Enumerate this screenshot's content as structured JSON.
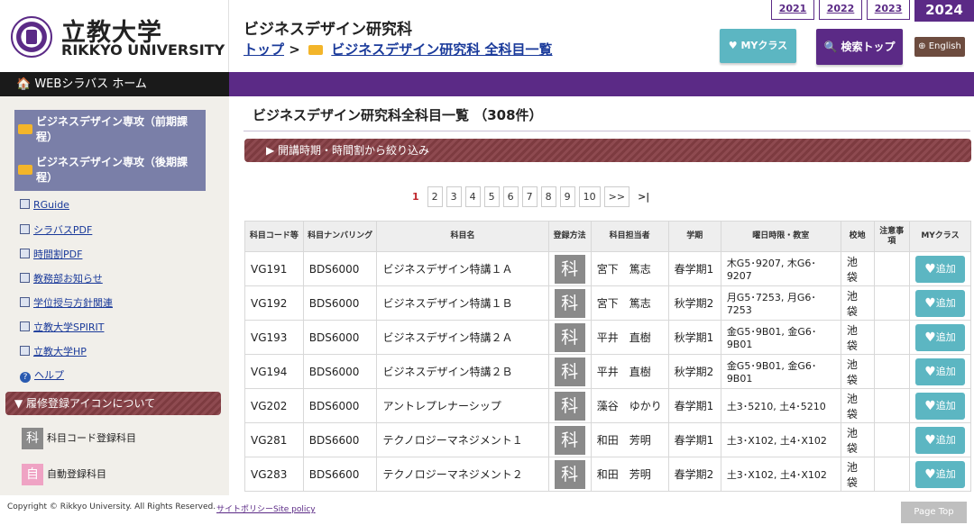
{
  "header": {
    "logo_jp": "立教大学",
    "logo_en": "RIKKYO UNIVERSITY",
    "title": "ビジネスデザイン研究科",
    "breadcrumb_top": "トップ",
    "breadcrumb_sep": ">",
    "breadcrumb_current": "ビジネスデザイン研究科 全科目一覧",
    "years": [
      "2021",
      "2022",
      "2023"
    ],
    "current_year": "2024",
    "my_class_label": "♥ MYクラス",
    "search_top_label": "🔍 検索トップ",
    "english_label": "⊕ English"
  },
  "nav": {
    "home_label": "WEBシラバス ホーム"
  },
  "sidebar": {
    "majors": [
      "ビジネスデザイン専攻（前期課程）",
      "ビジネスデザイン専攻（後期課程）"
    ],
    "links": [
      "RGuide",
      "シラバスPDF",
      "時間割PDF",
      "教務部お知らせ",
      "学位授与方針関連",
      "立教大学SPIRIT",
      "立教大学HP",
      "ヘルプ"
    ],
    "icon_section_title": "▼ 履修登録アイコンについて",
    "icon_items": [
      {
        "glyph": "科",
        "label": "科目コード登録科目",
        "color": "#8a8a8a"
      },
      {
        "glyph": "自",
        "label": "自動登録科目",
        "color": "#efa3c4"
      }
    ]
  },
  "main": {
    "title": "ビジネスデザイン研究科全科目一覧 （308件）",
    "filter_label": "▶ 開講時期・時間割から絞り込み",
    "pagination": [
      "1",
      "2",
      "3",
      "4",
      "5",
      "6",
      "7",
      "8",
      "9",
      "10",
      ">>",
      ">|"
    ],
    "current_page": "1"
  },
  "table": {
    "headers": [
      "科目コード等",
      "科目ナンバリング",
      "科目名",
      "登録方法",
      "科目担当者",
      "学期",
      "曜日時限・教室",
      "校地",
      "注意事項",
      "MYクラス"
    ],
    "rows": [
      {
        "code": "VG191",
        "numbering": "BDS6000",
        "name": "ビジネスデザイン特講１Ａ",
        "method": "科",
        "teacher": "宮下　篤志",
        "term": "春学期1",
        "schedule": "木G5･9207, 木G6･9207",
        "campus": "池袋",
        "note": "",
        "my": "追加"
      },
      {
        "code": "VG192",
        "numbering": "BDS6000",
        "name": "ビジネスデザイン特講１Ｂ",
        "method": "科",
        "teacher": "宮下　篤志",
        "term": "秋学期2",
        "schedule": "月G5･7253, 月G6･7253",
        "campus": "池袋",
        "note": "",
        "my": "追加"
      },
      {
        "code": "VG193",
        "numbering": "BDS6000",
        "name": "ビジネスデザイン特講２Ａ",
        "method": "科",
        "teacher": "平井　直樹",
        "term": "秋学期1",
        "schedule": "金G5･9B01, 金G6･9B01",
        "campus": "池袋",
        "note": "",
        "my": "追加"
      },
      {
        "code": "VG194",
        "numbering": "BDS6000",
        "name": "ビジネスデザイン特講２Ｂ",
        "method": "科",
        "teacher": "平井　直樹",
        "term": "秋学期2",
        "schedule": "金G5･9B01, 金G6･9B01",
        "campus": "池袋",
        "note": "",
        "my": "追加"
      },
      {
        "code": "VG202",
        "numbering": "BDS6000",
        "name": "アントレプレナーシップ",
        "method": "科",
        "teacher": "藻谷　ゆかり",
        "term": "春学期1",
        "schedule": "土3･5210, 土4･5210",
        "campus": "池袋",
        "note": "",
        "my": "追加"
      },
      {
        "code": "VG281",
        "numbering": "BDS6600",
        "name": "テクノロジーマネジメント１",
        "method": "科",
        "teacher": "和田　芳明",
        "term": "春学期1",
        "schedule": "土3･X102, 土4･X102",
        "campus": "池袋",
        "note": "",
        "my": "追加"
      },
      {
        "code": "VG283",
        "numbering": "BDS6600",
        "name": "テクノロジーマネジメント２",
        "method": "科",
        "teacher": "和田　芳明",
        "term": "春学期2",
        "schedule": "土3･X102, 土4･X102",
        "campus": "池袋",
        "note": "",
        "my": "追加"
      }
    ]
  },
  "footer": {
    "copyright": "Copyright © Rikkyo University. All Rights Reserved.",
    "policy": "サイトポリシーSite policy",
    "page_top": "Page Top"
  }
}
